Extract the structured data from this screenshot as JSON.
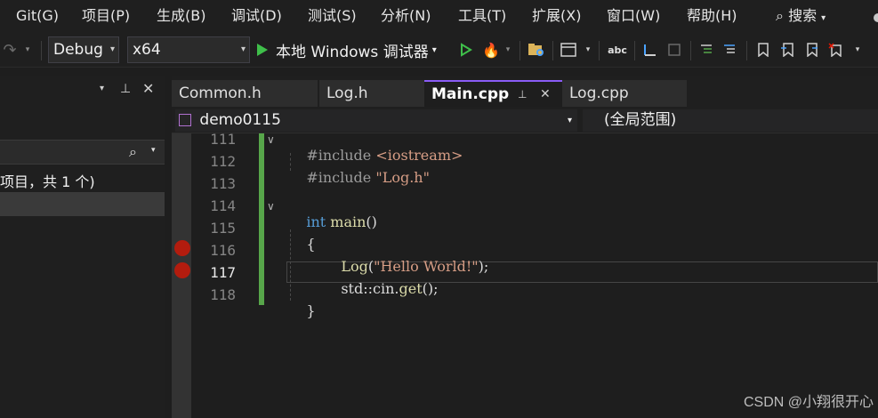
{
  "menu": {
    "items": [
      "Git(G)",
      "项目(P)",
      "生成(B)",
      "调试(D)",
      "测试(S)",
      "分析(N)",
      "工具(T)",
      "扩展(X)",
      "窗口(W)",
      "帮助(H)"
    ],
    "search_label": "搜索"
  },
  "toolbar": {
    "config": "Debug",
    "platform": "x64",
    "run_label": "本地 Windows 调试器"
  },
  "solution_explorer": {
    "info_text": "项目，共 1 个)"
  },
  "tabs": [
    {
      "label": "Common.h"
    },
    {
      "label": "Log.h"
    },
    {
      "label": "Main.cpp",
      "active": true
    },
    {
      "label": "Log.cpp"
    }
  ],
  "navbar": {
    "project": "demo0115",
    "scope": "(全局范围)"
  },
  "editor": {
    "line_numbers": [
      "111",
      "112",
      "113",
      "114",
      "115",
      "116",
      "117",
      "118"
    ],
    "current_line": "117",
    "breakpoint_lines": [
      "116",
      "117"
    ],
    "code": {
      "l111_pp": "#include ",
      "l111_str": "<iostream>",
      "l112_pp": "#include ",
      "l112_str": "\"Log.h\"",
      "l114_kw": "int",
      "l114_fn": " main",
      "l114_rest": "()",
      "l115": "{",
      "l116_fn": "Log",
      "l116_open": "(",
      "l116_str": "\"Hello World!\"",
      "l116_close": ");",
      "l117_ns": "std::cin.",
      "l117_fn": "get",
      "l117_rest": "();",
      "l118": "}"
    }
  },
  "watermark": "CSDN @小翔很开心",
  "colors": {
    "accent": "#8a5cf5",
    "breakpoint": "#e51400",
    "change_bar": "#57a64a",
    "keyword": "#569cd6",
    "string": "#d69d85"
  }
}
